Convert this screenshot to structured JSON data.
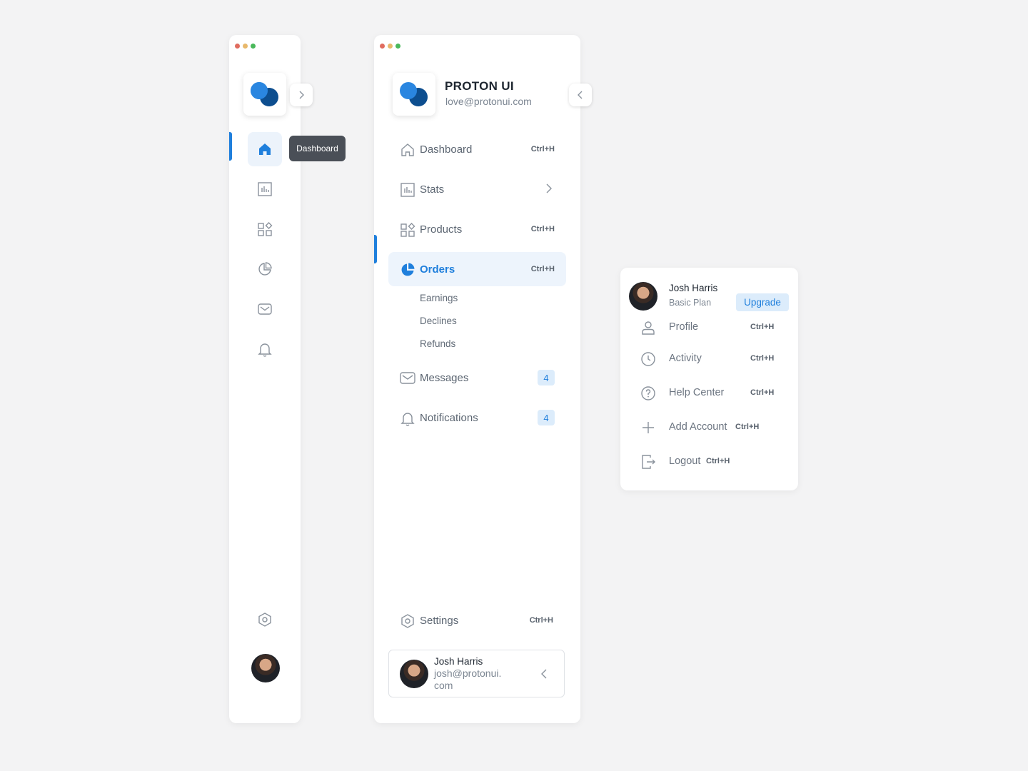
{
  "collapsed_sidebar": {
    "tooltip": "Dashboard",
    "icons": [
      "home-icon",
      "stats-icon",
      "products-icon",
      "orders-icon",
      "messages-icon",
      "notifications-icon"
    ],
    "settings_icon": "settings-icon"
  },
  "expanded_sidebar": {
    "brand": {
      "title": "PROTON UI",
      "email": "love@protonui.com"
    },
    "nav": [
      {
        "label": "Dashboard",
        "shortcut": "Ctrl+H",
        "icon": "home-icon"
      },
      {
        "label": "Stats",
        "icon": "stats-icon",
        "has_chevron": true
      },
      {
        "label": "Products",
        "shortcut": "Ctrl+H",
        "icon": "products-icon"
      },
      {
        "label": "Orders",
        "shortcut": "Ctrl+H",
        "icon": "orders-icon",
        "active": true
      },
      {
        "label": "Messages",
        "badge": "4",
        "icon": "messages-icon"
      },
      {
        "label": "Notifications",
        "badge": "4",
        "icon": "notifications-icon"
      }
    ],
    "orders_sub": [
      "Earnings",
      "Declines",
      "Refunds"
    ],
    "settings": {
      "label": "Settings",
      "shortcut": "Ctrl+H"
    },
    "user": {
      "name": "Josh Harris",
      "email": "josh@protonui. com"
    }
  },
  "popup": {
    "user": {
      "name": "Josh Harris",
      "plan": "Basic Plan",
      "upgrade_label": "Upgrade"
    },
    "items": [
      {
        "label": "Profile",
        "shortcut": "Ctrl+H",
        "icon": "user-icon"
      },
      {
        "label": "Activity",
        "shortcut": "Ctrl+H",
        "icon": "clock-icon"
      },
      {
        "label": "Help Center",
        "shortcut": "Ctrl+H",
        "icon": "help-icon"
      },
      {
        "label": "Add Account",
        "shortcut": "Ctrl+H",
        "icon": "plus-icon"
      },
      {
        "label": "Logout",
        "shortcut": "Ctrl+H",
        "icon": "logout-icon"
      }
    ]
  },
  "colors": {
    "accent": "#1f7fdc",
    "accent_dark": "#0d4e8f",
    "tooltip_bg": "#4a4f57",
    "badge_bg": "#dcecfb"
  }
}
